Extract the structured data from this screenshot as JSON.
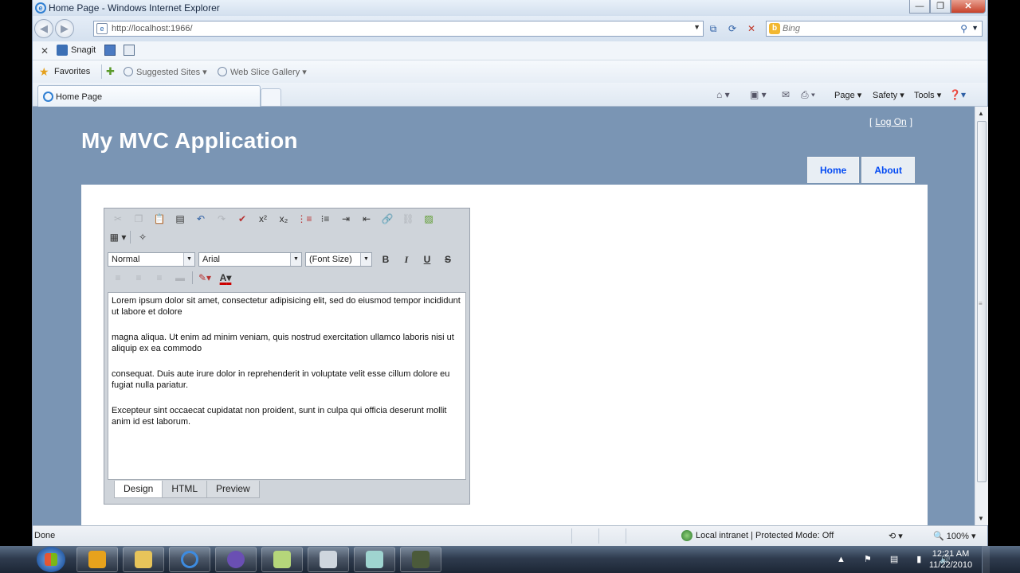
{
  "window": {
    "title": "Home Page - Windows Internet Explorer"
  },
  "address_bar": {
    "url": "http://localhost:1966/"
  },
  "search": {
    "placeholder": "Bing"
  },
  "toolbar": {
    "snagit_label": "Snagit"
  },
  "favorites_bar": {
    "favorites_label": "Favorites",
    "items": [
      {
        "label": "Suggested Sites ▾"
      },
      {
        "label": "Web Slice Gallery ▾"
      }
    ]
  },
  "tab": {
    "label": "Home Page"
  },
  "command_bar": {
    "page": "Page ▾",
    "safety": "Safety ▾",
    "tools": "Tools ▾"
  },
  "site": {
    "title": "My MVC Application",
    "logon_bracket_open": "[",
    "logon_link": "Log On",
    "logon_bracket_close": "]",
    "menu": [
      {
        "label": "Home"
      },
      {
        "label": "About"
      }
    ]
  },
  "editor": {
    "format_select": "Normal",
    "font_select": "Arial",
    "size_select": "(Font Size)",
    "bold": "B",
    "italic": "I",
    "underline": "U",
    "strike": "S",
    "font_color_glyph": "A",
    "superscript_glyph": "x²",
    "subscript_glyph": "x₂",
    "paragraphs": [
      "Lorem ipsum dolor sit amet, consectetur adipisicing elit, sed do eiusmod tempor incididunt ut labore et dolore",
      "magna aliqua. Ut enim ad minim veniam, quis nostrud exercitation ullamco laboris nisi ut aliquip ex ea commodo",
      "consequat. Duis aute irure dolor in reprehenderit in voluptate velit esse cillum dolore eu fugiat nulla pariatur.",
      "Excepteur sint occaecat cupidatat non proident, sunt in culpa qui officia deserunt mollit anim id est laborum."
    ],
    "mode_tabs": [
      {
        "label": "Design"
      },
      {
        "label": "HTML"
      },
      {
        "label": "Preview"
      }
    ]
  },
  "status_bar": {
    "status": "Done",
    "zone": "Local intranet | Protected Mode: Off",
    "zoom": "100%"
  },
  "taskbar": {
    "time": "12:21 AM",
    "date": "11/22/2010"
  },
  "colors": {
    "page_background": "#7a95b4",
    "menu_link": "#034af3",
    "menu_tab_bg": "#e8eef4"
  }
}
